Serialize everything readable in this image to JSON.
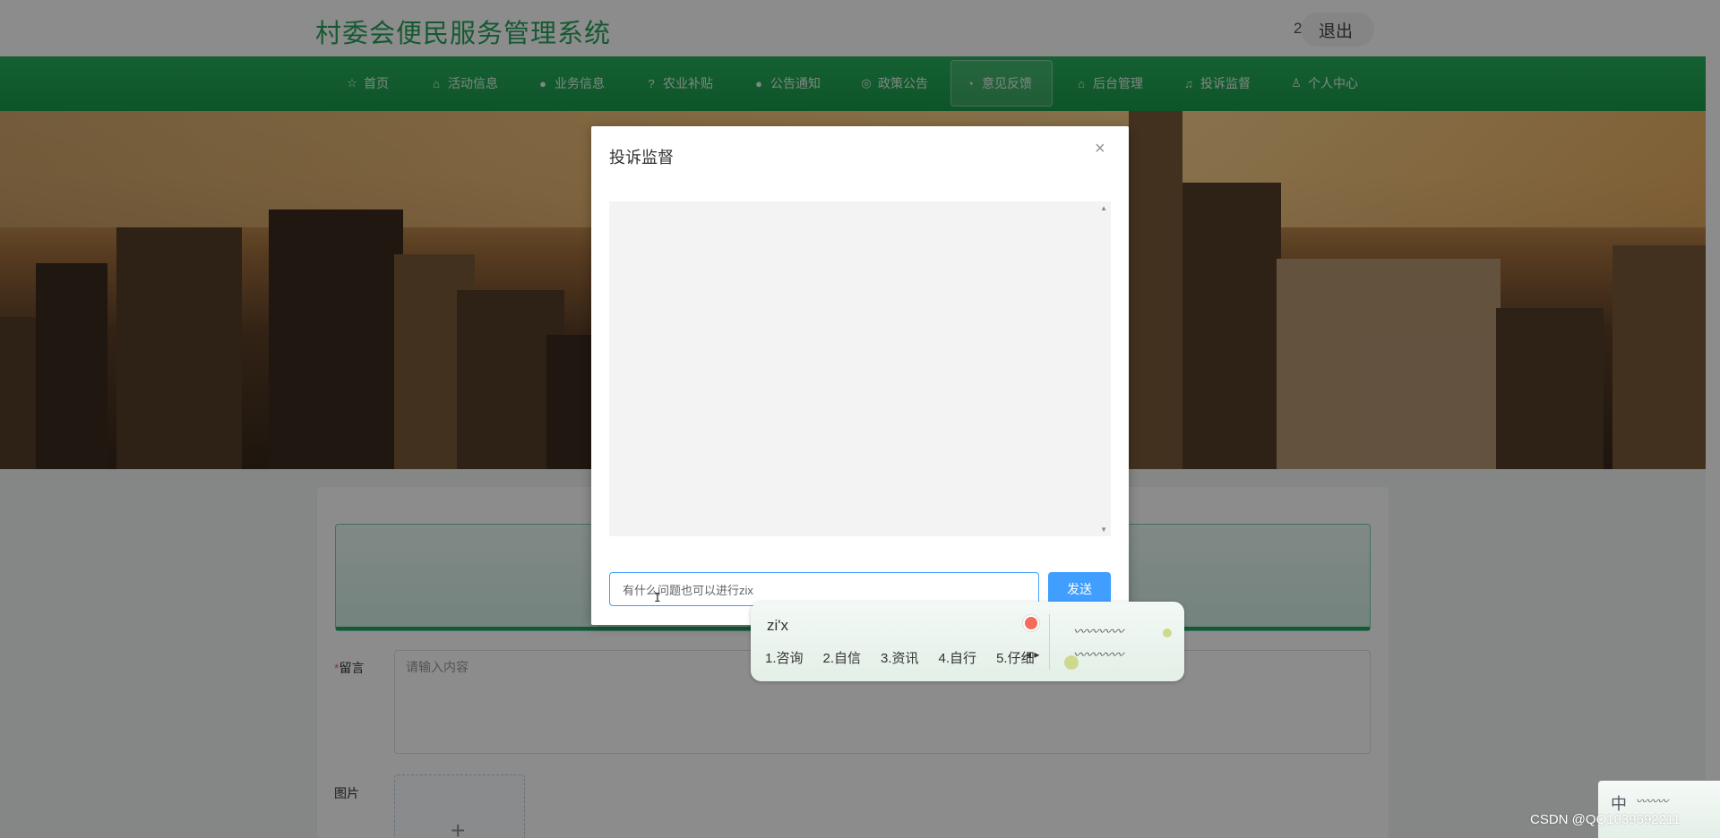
{
  "header": {
    "title": "村委会便民服务管理系统",
    "user_number": "2",
    "logout_label": "退出"
  },
  "nav": {
    "items": [
      {
        "label": "首页",
        "icon": "star-icon"
      },
      {
        "label": "活动信息",
        "icon": "bag-icon"
      },
      {
        "label": "业务信息",
        "icon": "info-icon"
      },
      {
        "label": "农业补贴",
        "icon": "question-icon"
      },
      {
        "label": "公告通知",
        "icon": "info-icon"
      },
      {
        "label": "政策公告",
        "icon": "globe-icon"
      },
      {
        "label": "意见反馈",
        "icon": "compass-icon"
      },
      {
        "label": "后台管理",
        "icon": "bag-icon"
      },
      {
        "label": "投诉监督",
        "icon": "headset-icon"
      },
      {
        "label": "个人中心",
        "icon": "user-icon"
      }
    ],
    "active": "意见反馈"
  },
  "dialog": {
    "title": "投诉监督",
    "input_value": "有什么问题也可以进行zix",
    "send_label": "发送"
  },
  "form": {
    "message_label": "留言",
    "message_placeholder": "请输入内容",
    "image_label": "图片",
    "required_mark": "*"
  },
  "ime": {
    "composition": "zi'x",
    "candidates": [
      "1.咨询",
      "2.自信",
      "3.资讯",
      "4.自行",
      "5.仔细"
    ],
    "status_mode": "中"
  },
  "watermark": "CSDN @QQ1039692211"
}
